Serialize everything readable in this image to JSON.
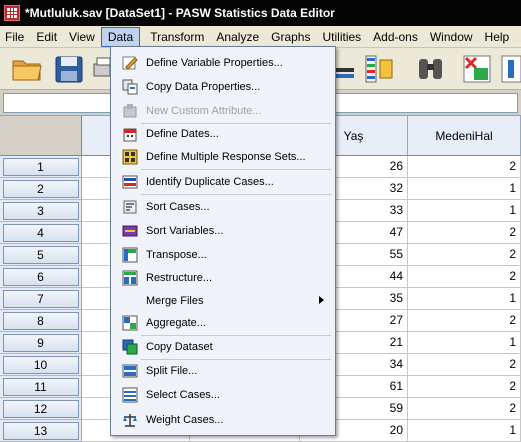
{
  "window": {
    "title": "*Mutluluk.sav [DataSet1] - PASW Statistics Data Editor"
  },
  "menubar": {
    "items": [
      "File",
      "Edit",
      "View",
      "Data",
      "Transform",
      "Analyze",
      "Graphs",
      "Utilities",
      "Add-ons",
      "Window",
      "Help"
    ],
    "active": "Data"
  },
  "data_menu": {
    "items": [
      {
        "label": "Define Variable Properties...",
        "icon": "define-variable-properties-icon",
        "enabled": true
      },
      {
        "label": "Copy Data Properties...",
        "icon": "copy-data-properties-icon",
        "enabled": true
      },
      {
        "label": "New Custom Attribute...",
        "icon": "new-custom-attribute-icon",
        "enabled": false
      },
      {
        "label": "Define Dates...",
        "icon": "define-dates-icon",
        "enabled": true
      },
      {
        "label": "Define Multiple Response Sets...",
        "icon": "multiple-response-sets-icon",
        "enabled": true
      },
      {
        "label": "Identify Duplicate Cases...",
        "icon": "identify-duplicates-icon",
        "enabled": true
      },
      {
        "label": "Sort Cases...",
        "icon": "sort-cases-icon",
        "enabled": true
      },
      {
        "label": "Sort Variables...",
        "icon": "sort-variables-icon",
        "enabled": true
      },
      {
        "label": "Transpose...",
        "icon": "transpose-icon",
        "enabled": true
      },
      {
        "label": "Restructure...",
        "icon": "restructure-icon",
        "enabled": true
      },
      {
        "label": "Merge Files",
        "icon": "",
        "enabled": true,
        "submenu": true
      },
      {
        "label": "Aggregate...",
        "icon": "aggregate-icon",
        "enabled": true
      },
      {
        "label": "Copy Dataset",
        "icon": "copy-dataset-icon",
        "enabled": true
      },
      {
        "label": "Split File...",
        "icon": "split-file-icon",
        "enabled": true
      },
      {
        "label": "Select Cases...",
        "icon": "select-cases-icon",
        "enabled": true
      },
      {
        "label": "Weight Cases...",
        "icon": "weight-cases-icon",
        "enabled": true
      }
    ]
  },
  "grid": {
    "columns": [
      "Yaş",
      "MedeniHal"
    ],
    "rows": [
      {
        "n": "1",
        "yas": "26",
        "medeni": "2"
      },
      {
        "n": "2",
        "yas": "32",
        "medeni": "1"
      },
      {
        "n": "3",
        "yas": "33",
        "medeni": "1"
      },
      {
        "n": "4",
        "yas": "47",
        "medeni": "2"
      },
      {
        "n": "5",
        "yas": "55",
        "medeni": "2"
      },
      {
        "n": "6",
        "yas": "44",
        "medeni": "2"
      },
      {
        "n": "7",
        "yas": "35",
        "medeni": "1"
      },
      {
        "n": "8",
        "yas": "27",
        "medeni": "2"
      },
      {
        "n": "9",
        "yas": "21",
        "medeni": "1"
      },
      {
        "n": "10",
        "yas": "34",
        "medeni": "2"
      },
      {
        "n": "11",
        "yas": "61",
        "medeni": "2"
      },
      {
        "n": "12",
        "yas": "59",
        "medeni": "2"
      },
      {
        "n": "13",
        "yas": "20",
        "medeni": "1"
      }
    ]
  },
  "colors": {
    "titlebar": "#050505",
    "menu_highlight": "#c1d2ee",
    "dropdown_bg": "#f0f4fa"
  }
}
